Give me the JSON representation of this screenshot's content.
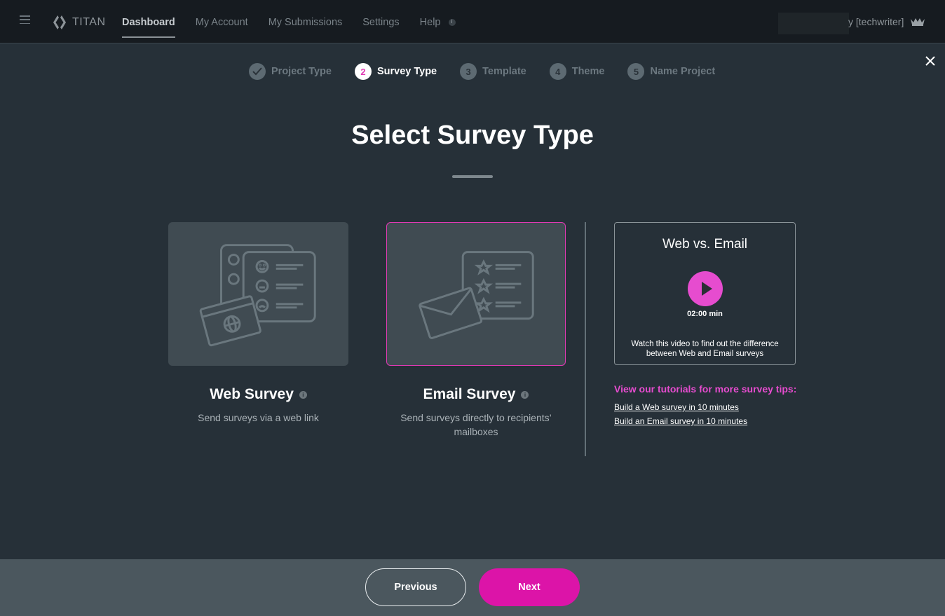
{
  "app": {
    "logo_text": "TITAN"
  },
  "nav": {
    "items": [
      {
        "label": "Dashboard",
        "active": true
      },
      {
        "label": "My Account",
        "active": false
      },
      {
        "label": "My Submissions",
        "active": false
      },
      {
        "label": "Settings",
        "active": false
      },
      {
        "label": "Help",
        "active": false
      }
    ],
    "help_info_glyph": "i"
  },
  "account": {
    "visible_name": "y [techwriter]",
    "icon": "crown-icon"
  },
  "stepper": {
    "steps": [
      {
        "number": "✓",
        "label": "Project Type",
        "state": "complete"
      },
      {
        "number": "2",
        "label": "Survey Type",
        "state": "active"
      },
      {
        "number": "3",
        "label": "Template",
        "state": "upcoming"
      },
      {
        "number": "4",
        "label": "Theme",
        "state": "upcoming"
      },
      {
        "number": "5",
        "label": "Name Project",
        "state": "upcoming"
      }
    ]
  },
  "main": {
    "title": "Select Survey Type",
    "options": [
      {
        "title": "Web Survey",
        "description": "Send surveys via a web link",
        "selected": false,
        "info_glyph": "i"
      },
      {
        "title": "Email Survey",
        "description": "Send surveys directly to recipients’ mailboxes",
        "selected": true,
        "info_glyph": "i"
      }
    ]
  },
  "video": {
    "title": "Web vs. Email",
    "duration": "02:00 min",
    "description": "Watch this video to find out the difference between Web and Email surveys"
  },
  "tutorials": {
    "heading": "View our tutorials for more survey tips:",
    "links": [
      "Build a Web survey in 10 minutes",
      "Build an Email survey in 10 minutes"
    ]
  },
  "footer": {
    "previous_label": "Previous",
    "next_label": "Next"
  },
  "colors": {
    "accent": "#dc14a8",
    "accent_light": "#e64ccf",
    "background": "#263038",
    "topbar": "#161b20",
    "footer": "#4b575e"
  }
}
